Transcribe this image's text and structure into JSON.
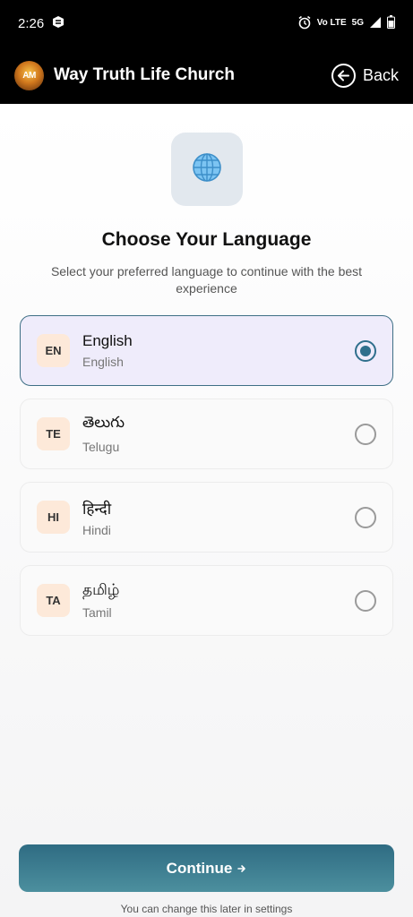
{
  "status_bar": {
    "time": "2:26",
    "network": "5G",
    "volte": "Vo LTE"
  },
  "header": {
    "title": "Way Truth Life Church",
    "logo_text": "AM",
    "back_label": "Back"
  },
  "main": {
    "heading": "Choose Your Language",
    "subheading": "Select your preferred language to continue with the best experience",
    "languages": [
      {
        "code": "EN",
        "native": "English",
        "english": "English",
        "selected": true
      },
      {
        "code": "TE",
        "native": "తెలుగు",
        "english": "Telugu",
        "selected": false
      },
      {
        "code": "HI",
        "native": "हिन्दी",
        "english": "Hindi",
        "selected": false
      },
      {
        "code": "TA",
        "native": "தமிழ்",
        "english": "Tamil",
        "selected": false
      }
    ],
    "continue_label": "Continue",
    "footnote": "You can change this later in settings"
  },
  "colors": {
    "accent": "#2f6f8c",
    "selected_bg": "#efecfb",
    "badge_bg": "#fde9d9"
  },
  "icons": {
    "globe": "globe-icon",
    "back": "arrow-left-circle-icon",
    "continue": "arrow-right-icon"
  }
}
